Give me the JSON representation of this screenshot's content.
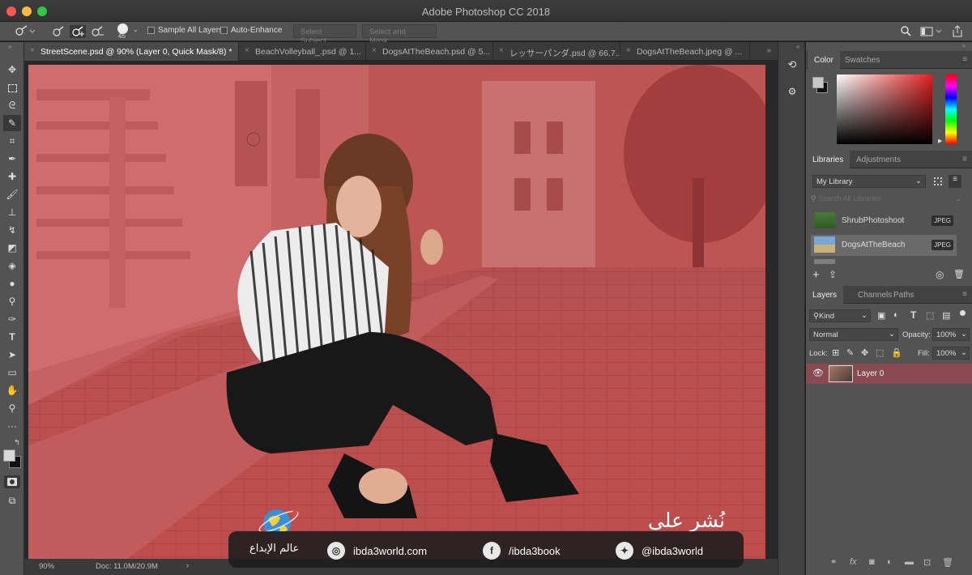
{
  "window": {
    "title": "Adobe Photoshop CC 2018"
  },
  "options_bar": {
    "brush_size": "45",
    "sample_all_layers": "Sample All Layers",
    "auto_enhance": "Auto-Enhance",
    "select_subject": "Select Subject",
    "select_and_mask": "Select and Mask..."
  },
  "tabs": [
    {
      "label": "StreetScene.psd @ 90% (Layer 0, Quick Mask/8) *"
    },
    {
      "label": "BeachVolleyball_.psd @ 1..."
    },
    {
      "label": "DogsAtTheBeach.psd @ 5..."
    },
    {
      "label": "レッサーパンダ.psd @ 66.7..."
    },
    {
      "label": "DogsAtTheBeach.jpeg @ ..."
    }
  ],
  "status": {
    "zoom": "90%",
    "doc": "Doc: 11.0M/20.9M"
  },
  "color_panel": {
    "tabs": [
      "Color",
      "Swatches"
    ]
  },
  "libraries_panel": {
    "tabs": [
      "Libraries",
      "Adjustments"
    ],
    "library": "My Library",
    "search_placeholder": "Search All Libraries",
    "items": [
      {
        "name": "ShrubPhotoshoot",
        "type": "JPEG"
      },
      {
        "name": "DogsAtTheBeach",
        "type": "JPEG"
      }
    ]
  },
  "layers_panel": {
    "tabs": [
      "Layers",
      "Channels",
      "Paths"
    ],
    "filter": "Kind",
    "blend_mode": "Normal",
    "opacity_label": "Opacity:",
    "opacity": "100%",
    "lock_label": "Lock:",
    "fill_label": "Fill:",
    "fill": "100%",
    "layer_name": "Layer 0"
  },
  "watermark": {
    "heading": "نُشر على",
    "brand": "عالم الإبداع",
    "website": "ibda3world.com",
    "facebook": "/ibda3book",
    "twitter": "@ibda3world"
  },
  "colors": {
    "quick_mask_red": "#b74a4a",
    "layer_highlight": "#8a4a52",
    "panel_bg": "#535353",
    "dark_bg": "#282828"
  }
}
